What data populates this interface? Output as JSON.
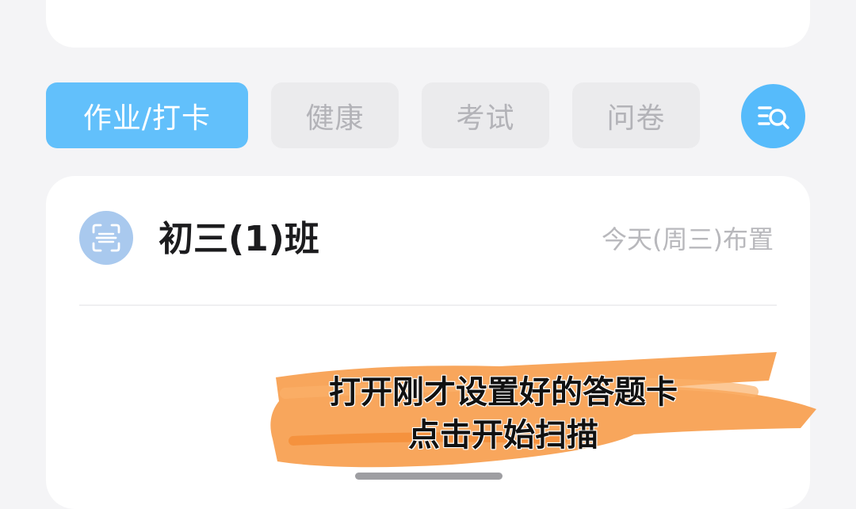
{
  "tabs": [
    {
      "label": "作业/打卡",
      "active": true
    },
    {
      "label": "健康",
      "active": false
    },
    {
      "label": "考试",
      "active": false
    },
    {
      "label": "问卷",
      "active": false
    }
  ],
  "search_button": {
    "icon": "list-search-icon"
  },
  "class_card": {
    "avatar_icon": "scan-icon",
    "name": "初三(1)班",
    "date": "今天(周三)布置"
  },
  "caption": {
    "line1": "打开刚才设置好的答题卡",
    "line2": "点击开始扫描"
  },
  "colors": {
    "accent": "#62c0fb",
    "avatar": "#a9c9ee",
    "caption_brush": "#f79a45"
  }
}
